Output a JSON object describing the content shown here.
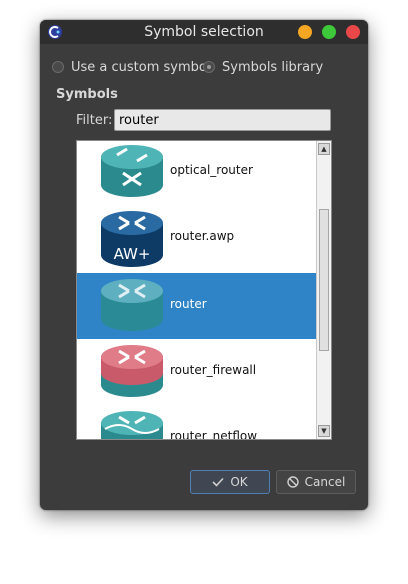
{
  "window": {
    "title": "Symbol selection"
  },
  "source": {
    "custom_label": "Use a custom symbol",
    "library_label": "Symbols library",
    "selected": "library"
  },
  "group": {
    "title": "Symbols"
  },
  "filter": {
    "label": "Filter:",
    "value": "router"
  },
  "symbols": [
    {
      "label": "optical_router",
      "icon": "optical-router-icon"
    },
    {
      "label": "router.awp",
      "icon": "router-awp-icon",
      "badge": "AW+"
    },
    {
      "label": "router",
      "icon": "router-icon",
      "selected": true
    },
    {
      "label": "router_firewall",
      "icon": "router-firewall-icon"
    },
    {
      "label": "router_netflow",
      "icon": "router-netflow-icon"
    }
  ],
  "buttons": {
    "ok_label": "OK",
    "cancel_label": "Cancel"
  },
  "colors": {
    "selection": "#2f84c7",
    "window_bg": "#3c3c3c"
  }
}
